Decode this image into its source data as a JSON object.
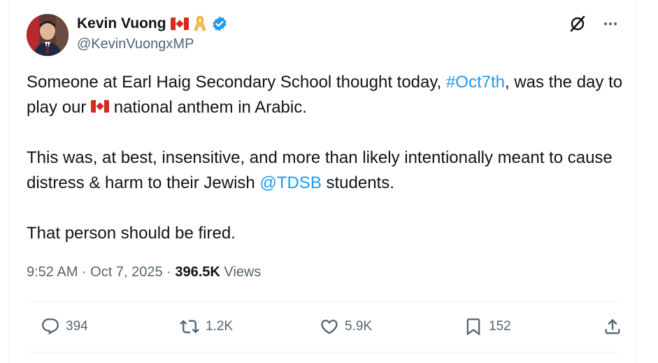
{
  "author": {
    "name": "Kevin Vuong",
    "handle": "@KevinVuongxMP"
  },
  "tweet": {
    "p1_a": "Someone at Earl Haig Secondary School thought today, ",
    "p1_hashtag": "#Oct7th",
    "p1_b": ", was the day to play our ",
    "p1_c": " national anthem in Arabic.",
    "p2_a": "This was, at best, insensitive, and more than likely intentionally meant to cause distress & harm to their Jewish ",
    "p2_mention": "@TDSB",
    "p2_b": " students.",
    "p3": "That person should be fired."
  },
  "meta": {
    "time": "9:52 AM",
    "sep1": " · ",
    "date": "Oct 7, 2025",
    "sep2": " · ",
    "views_count": "396.5K",
    "views_label": " Views"
  },
  "actions": {
    "replies": "394",
    "reposts": "1.2K",
    "likes": "5.9K",
    "bookmarks": "152"
  },
  "colors": {
    "link": "#1d9bf0",
    "text": "#0f1419",
    "secondary": "#536471",
    "verified": "#1d9bf0"
  }
}
